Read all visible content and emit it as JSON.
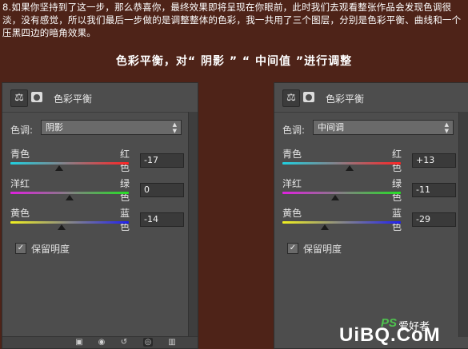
{
  "intro_text": "8.如果你坚持到了这一步，那么恭喜你，最终效果即将呈现在你眼前，此时我们去观看整张作品会发现色调很淡，没有感觉，所以我们最后一步做的是调整整体的色彩，我一共用了三个图层，分别是色彩平衡、曲线和一个压黑四边的暗角效果。",
  "heading": "色彩平衡，对“ 阴影 ” “ 中间值 ”进行调整",
  "panels": [
    {
      "title": "色彩平衡",
      "tone_label": "色调:",
      "tone_value": "阴影",
      "rows": [
        {
          "left": "青色",
          "right": "红色",
          "value": "-17",
          "level": -17
        },
        {
          "left": "洋红",
          "right": "绿色",
          "value": "0",
          "level": 0
        },
        {
          "left": "黄色",
          "right": "蓝色",
          "value": "-14",
          "level": -14
        }
      ],
      "preserve_luminosity": "保留明度",
      "preserve_checked": true
    },
    {
      "title": "色彩平衡",
      "tone_label": "色调:",
      "tone_value": "中间调",
      "rows": [
        {
          "left": "青色",
          "right": "红色",
          "value": "+13",
          "level": 13
        },
        {
          "left": "洋红",
          "right": "绿色",
          "value": "-11",
          "level": -11
        },
        {
          "left": "黄色",
          "right": "蓝色",
          "value": "-29",
          "level": -29
        }
      ],
      "preserve_luminosity": "保留明度",
      "preserve_checked": true
    }
  ],
  "slider_range": [
    -100,
    100
  ],
  "icons": {
    "balance": "balance-scale-icon",
    "mask": "layer-mask-icon",
    "checkmark": "✓"
  },
  "watermark": {
    "main": "UiBQ.CoM",
    "ps": "PS",
    "cn": "爱好者"
  },
  "colors": {
    "background": "#4e2318",
    "panel": "#4d4d4d"
  }
}
